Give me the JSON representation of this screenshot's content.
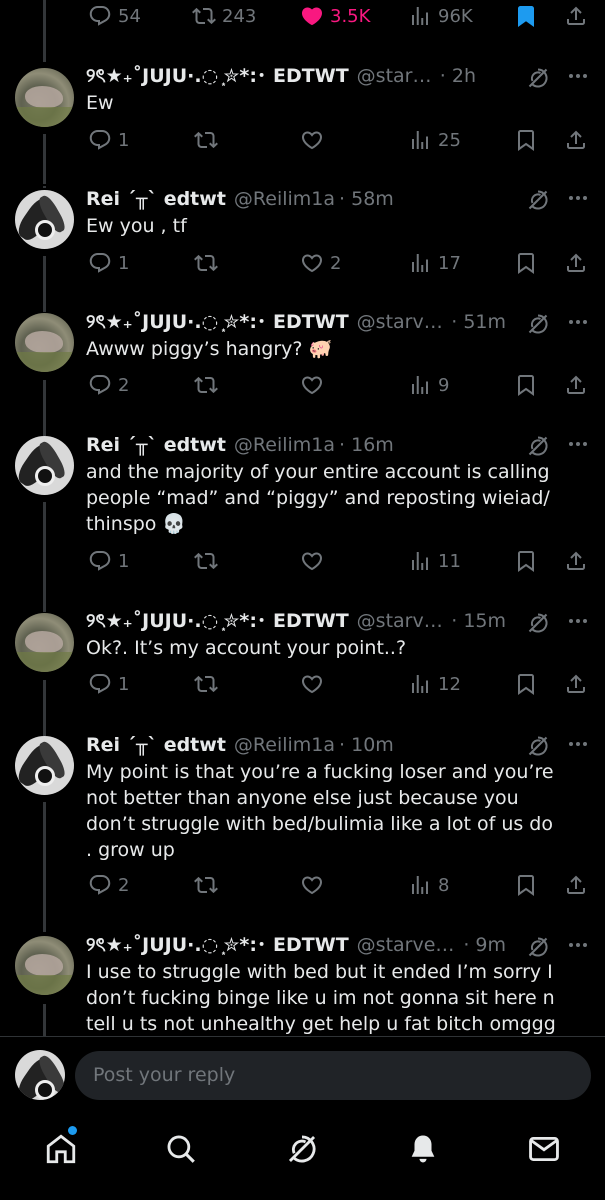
{
  "parent_actions": {
    "replies": "54",
    "reposts": "243",
    "likes": "3.5K",
    "views": "96K"
  },
  "tweets": [
    {
      "name": "୨ৎ★₊˚JUJU·.◌ ͙✮*:･ EDTWT",
      "handle": "@starvedJuj...",
      "time": "· 2h",
      "text": "Ew",
      "replies": "1",
      "reposts": "",
      "likes": "",
      "views": "25"
    },
    {
      "name": "Rei ˊ╥ˋ edtwt",
      "handle": "@Reilim1a",
      "time": "· 58m",
      "text": "Ew you , tf",
      "replies": "1",
      "reposts": "",
      "likes": "2",
      "views": "17"
    },
    {
      "name": "୨ৎ★₊˚JUJU·.◌ ͙✮*:･ EDTWT",
      "handle": "@starvedJ...",
      "time": "· 51m",
      "text": "Awww piggy’s hangry? 🐖",
      "replies": "2",
      "reposts": "",
      "likes": "",
      "views": "9"
    },
    {
      "name": "Rei ˊ╥ˋ edtwt",
      "handle": "@Reilim1a",
      "time": "· 16m",
      "text": "and the majority of your entire account is calling people “mad” and “piggy” and reposting wieiad/ thinspo 💀",
      "replies": "1",
      "reposts": "",
      "likes": "",
      "views": "11"
    },
    {
      "name": "୨ৎ★₊˚JUJU·.◌ ͙✮*:･ EDTWT",
      "handle": "@starvedJ...",
      "time": "· 15m",
      "text": "Ok?. It’s my account your point..?",
      "replies": "1",
      "reposts": "",
      "likes": "",
      "views": "12"
    },
    {
      "name": "Rei ˊ╥ˋ edtwt",
      "handle": "@Reilim1a",
      "time": "· 10m",
      "text": "My point is that you’re a fucking loser and you’re not better than anyone else just because you don’t struggle with bed/bulimia like a lot of us do . grow up",
      "replies": "2",
      "reposts": "",
      "likes": "",
      "views": "8"
    },
    {
      "name": "୨ৎ★₊˚JUJU·.◌ ͙✮*:･ EDTWT",
      "handle": "@starvedJu...",
      "time": "· 9m",
      "text": "I use to struggle with bed but it ended I’m sorry I don’t fucking binge like u im not gonna sit here n tell u ts not unhealthy get help u fat bitch omggg stay tf",
      "replies": "",
      "reposts": "",
      "likes": "",
      "views": ""
    }
  ],
  "reply_bar": {
    "placeholder": "Post your reply"
  },
  "tabs": [
    "home-icon",
    "search-icon",
    "grok-icon",
    "notifications-icon",
    "messages-icon"
  ],
  "colors": {
    "background": "#000000",
    "text": "#e7e9ea",
    "muted": "#71767b",
    "like_active": "#f91880",
    "bookmark_active": "#1d9bf0"
  }
}
